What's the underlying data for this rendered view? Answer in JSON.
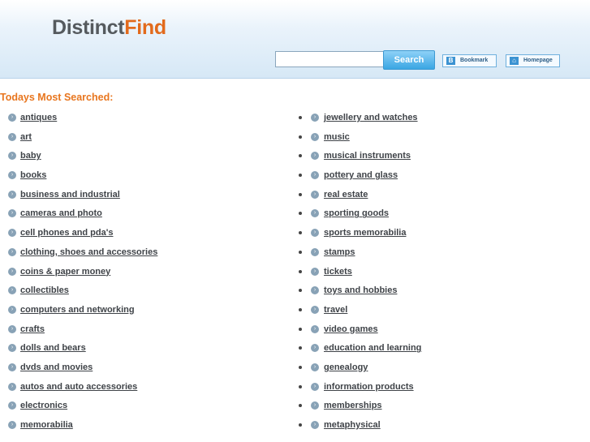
{
  "header": {
    "logo_part1": "Distinct",
    "logo_part2": "Find",
    "search_value": "",
    "search_button": "Search",
    "bookmark_label": "Bookmark",
    "homepage_label": "Homepage"
  },
  "section_title": "Todays Most Searched:",
  "left_links": [
    "antiques",
    "art",
    "baby",
    "books",
    "business and industrial",
    "cameras and photo",
    "cell phones and pda's",
    "clothing, shoes and accessories",
    "coins & paper money",
    "collectibles",
    "computers and networking",
    "crafts",
    "dolls and bears",
    "dvds and movies",
    "autos and auto accessories",
    "electronics",
    "memorabilia"
  ],
  "right_links": [
    "jewellery and watches",
    "music",
    "musical instruments",
    "pottery and glass",
    "real estate",
    "sporting goods",
    "sports memorabilia",
    "stamps",
    "tickets",
    "toys and hobbies",
    "travel",
    "video games",
    "education and learning",
    "genealogy",
    "information products",
    "memberships",
    "metaphysical"
  ],
  "colors": {
    "accent_orange": "#e8761f",
    "search_blue": "#3aa6e3",
    "link_gray": "#3f4348"
  },
  "icons": {
    "bullet": "arrow-circle-icon",
    "button_bookmark": "bookmark-icon",
    "button_home": "home-icon"
  }
}
